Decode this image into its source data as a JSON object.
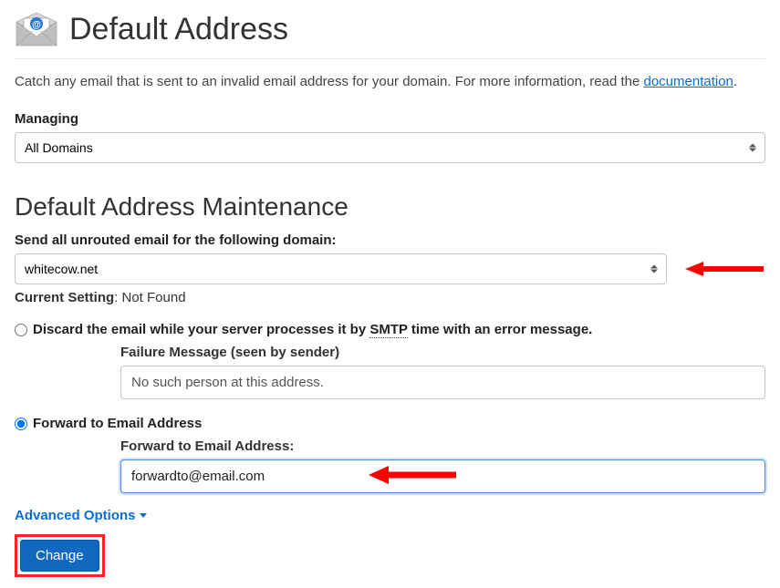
{
  "header": {
    "title": "Default Address"
  },
  "intro": {
    "text_before": "Catch any email that is sent to an invalid email address for your domain. For more information, read the ",
    "link_text": "documentation",
    "text_after": "."
  },
  "managing": {
    "label": "Managing",
    "selected": "All Domains"
  },
  "maintenance": {
    "title": "Default Address Maintenance",
    "domain_label": "Send all unrouted email for the following domain:",
    "domain_selected": "whitecow.net",
    "current_setting_label": "Current Setting",
    "current_setting_value": ": Not Found"
  },
  "options": {
    "discard": {
      "label_before": "Discard the email while your server processes it by ",
      "smtp": "SMTP",
      "label_after": " time with an error message.",
      "failure_label": "Failure Message (seen by sender)",
      "failure_value": "No such person at this address."
    },
    "forward": {
      "label": "Forward to Email Address",
      "sub_label": "Forward to Email Address:",
      "value": "forwardto@email.com"
    }
  },
  "advanced": {
    "label": "Advanced Options"
  },
  "submit": {
    "label": "Change"
  }
}
